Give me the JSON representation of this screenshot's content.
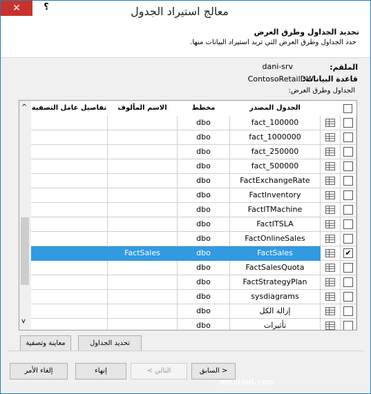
{
  "window": {
    "title": "معالج استيراد الجدول",
    "close_glyph": "✕",
    "help_glyph": "؟"
  },
  "header": {
    "title": "تحديد الجداول وطرق العرض",
    "subtitle": "حدد الجداول وطرق العرض التي تريد استيراد البيانات منها."
  },
  "connection": {
    "server_label": "الملقم:",
    "server_value": "dani-srv",
    "database_label": "قاعدة البيانات:",
    "database_value": "ContosoRetailDW",
    "tables_label": "الجداول وطرق العرض:"
  },
  "grid": {
    "columns": {
      "source": "الجدول المصدر",
      "schema": "مخطط",
      "friendly": "الاسم المألوف",
      "filter": "تفاصيل عامل التصفية"
    },
    "rows": [
      {
        "checked": false,
        "source": "fact_100000",
        "schema": "dbo",
        "friendly": "",
        "filter": ""
      },
      {
        "checked": false,
        "source": "fact_1000000",
        "schema": "dbo",
        "friendly": "",
        "filter": ""
      },
      {
        "checked": false,
        "source": "fact_250000",
        "schema": "dbo",
        "friendly": "",
        "filter": ""
      },
      {
        "checked": false,
        "source": "fact_500000",
        "schema": "dbo",
        "friendly": "",
        "filter": ""
      },
      {
        "checked": false,
        "source": "FactExchangeRate",
        "schema": "dbo",
        "friendly": "",
        "filter": ""
      },
      {
        "checked": false,
        "source": "FactInventory",
        "schema": "dbo",
        "friendly": "",
        "filter": ""
      },
      {
        "checked": false,
        "source": "FactITMachine",
        "schema": "dbo",
        "friendly": "",
        "filter": ""
      },
      {
        "checked": false,
        "source": "FactITSLA",
        "schema": "dbo",
        "friendly": "",
        "filter": ""
      },
      {
        "checked": false,
        "source": "FactOnlineSales",
        "schema": "dbo",
        "friendly": "",
        "filter": ""
      },
      {
        "checked": true,
        "source": "FactSales",
        "schema": "dbo",
        "friendly": "FactSales",
        "filter": ""
      },
      {
        "checked": false,
        "source": "FactSalesQuota",
        "schema": "dbo",
        "friendly": "",
        "filter": ""
      },
      {
        "checked": false,
        "source": "FactStrategyPlan",
        "schema": "dbo",
        "friendly": "",
        "filter": ""
      },
      {
        "checked": false,
        "source": "sysdiagrams",
        "schema": "dbo",
        "friendly": "",
        "filter": ""
      },
      {
        "checked": false,
        "source": "إزالة الكل",
        "schema": "dbo",
        "friendly": "",
        "filter": ""
      },
      {
        "checked": false,
        "source": "تأثيرات",
        "schema": "dbo",
        "friendly": "",
        "filter": ""
      }
    ],
    "check_mark": "✔",
    "scroll_up_glyph": "^",
    "scroll_down_glyph": "v"
  },
  "actions": {
    "select_related": "تحديد الجداول المرتبطة",
    "preview_filter": "معاينة وتصفية"
  },
  "footer": {
    "back": "< السابق",
    "next": "التالي >",
    "finish": "إنهاء",
    "cancel": "إلغاء الأمر",
    "watermark": "mostaql.com"
  },
  "colors": {
    "close": "#c7332d",
    "selection": "#3399e0",
    "border": "#1f7bb5"
  }
}
